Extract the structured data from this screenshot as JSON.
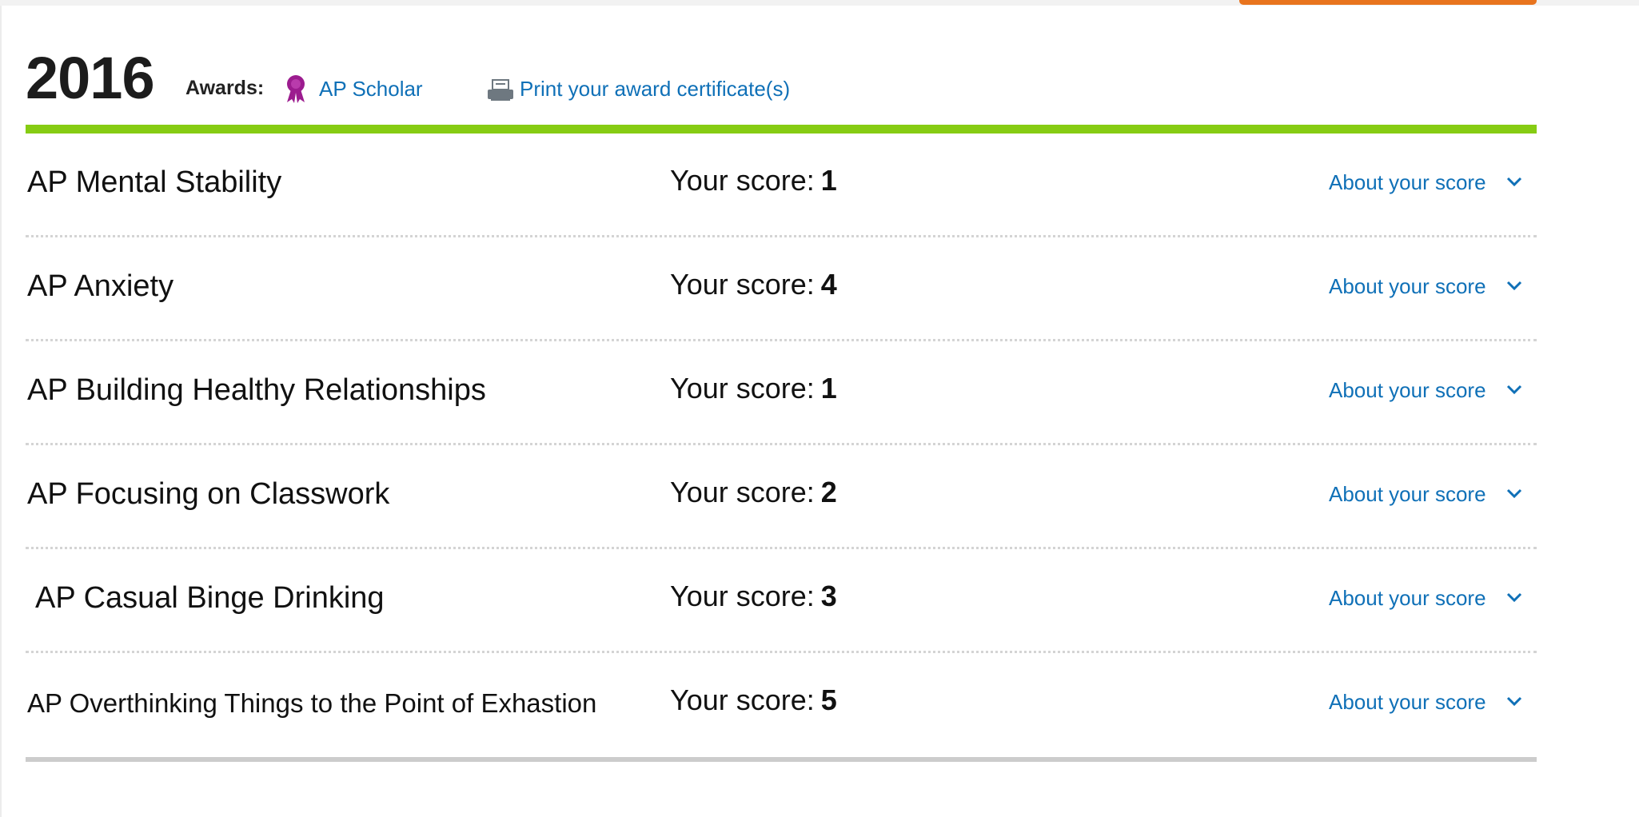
{
  "header": {
    "year": "2016",
    "awards_label": "Awards:",
    "award_name": "AP Scholar",
    "print_link": "Print your award certificate(s)"
  },
  "colors": {
    "accent_green": "#86cc13",
    "link_blue": "#0f70b7",
    "award_purple": "#9c1c8f",
    "orange": "#e8741e"
  },
  "score_label": "Your score:",
  "about_label": "About your score",
  "courses": [
    {
      "name": "AP Mental Stability",
      "score": "1"
    },
    {
      "name": "AP Anxiety",
      "score": "4"
    },
    {
      "name": "AP Building Healthy Relationships",
      "score": "1"
    },
    {
      "name": "AP Focusing on Classwork",
      "score": "2"
    },
    {
      "name": "AP Casual Binge Drinking",
      "score": "3"
    },
    {
      "name": "AP Overthinking Things to the Point of Exhastion",
      "score": "5"
    }
  ],
  "icons": {
    "award": "ribbon-medal-icon",
    "print": "printer-icon",
    "expand": "chevron-down-icon"
  }
}
